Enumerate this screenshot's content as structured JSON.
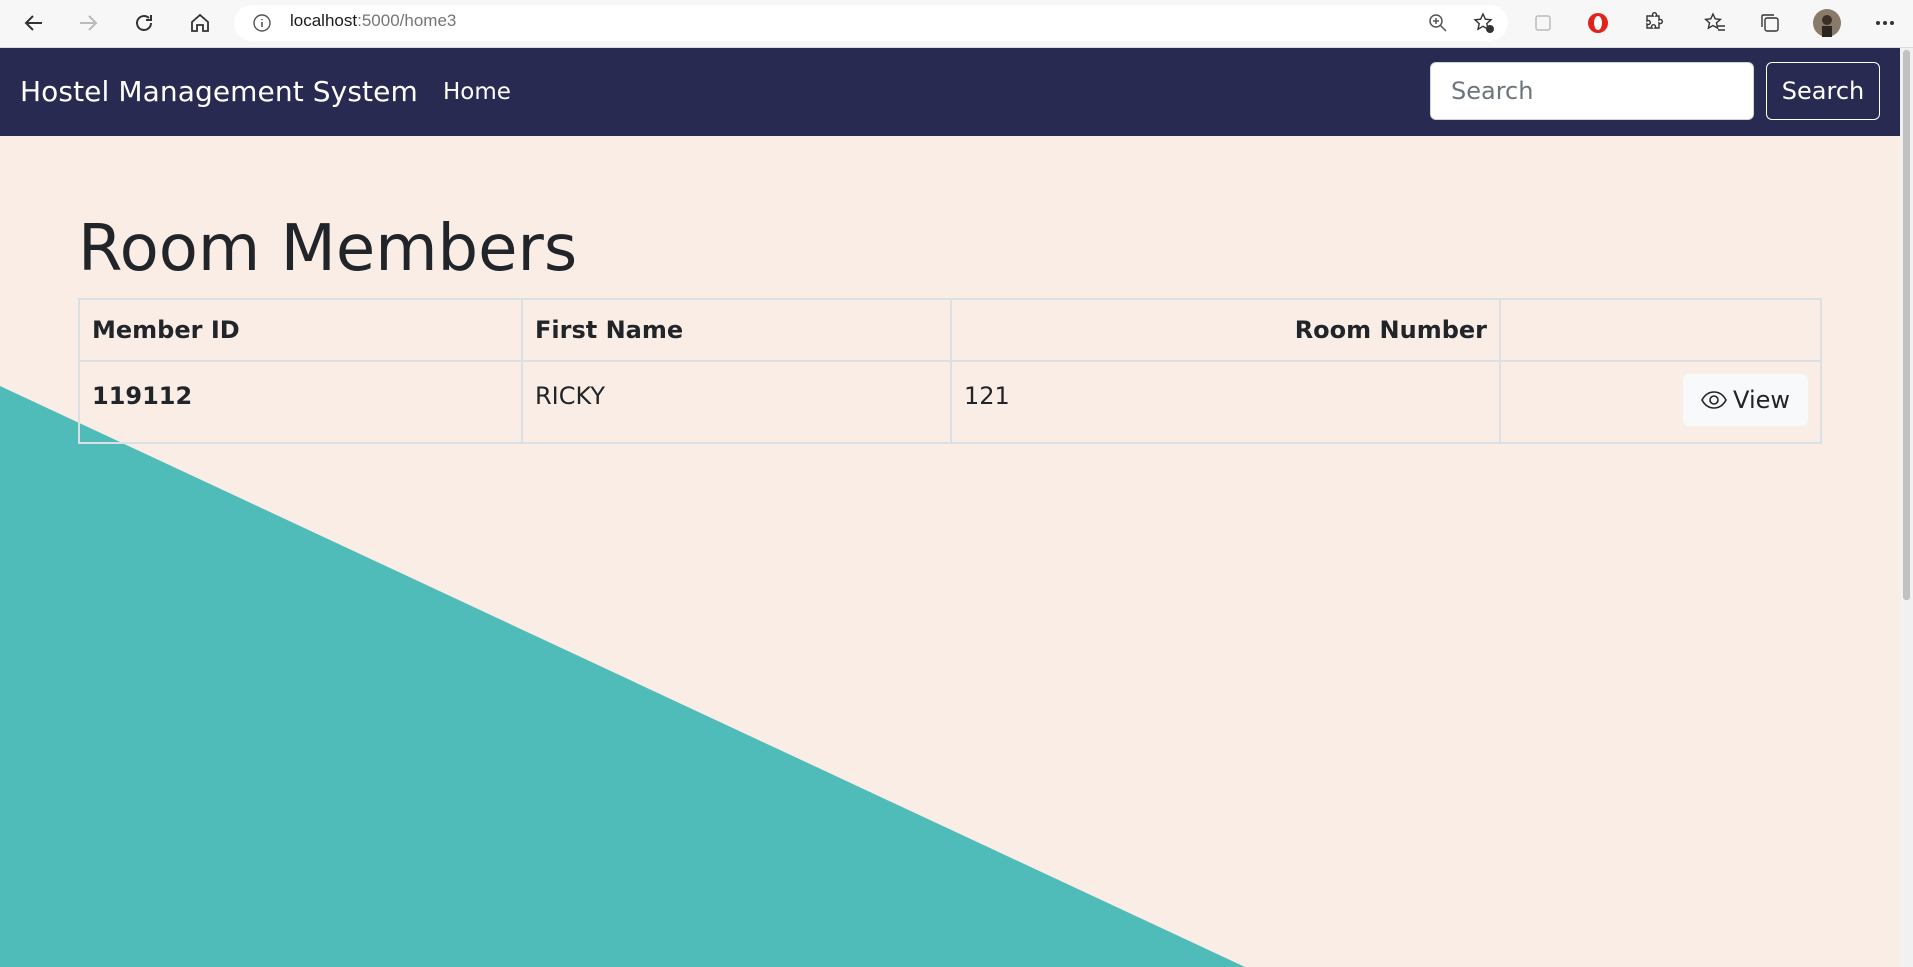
{
  "browser": {
    "url_host": "localhost",
    "url_path": ":5000/home3"
  },
  "navbar": {
    "brand": "Hostel Management System",
    "home": "Home",
    "search_placeholder": "Search",
    "search_button": "Search"
  },
  "main": {
    "title": "Room Members",
    "table": {
      "headers": [
        "Member ID",
        "First Name",
        "Room Number",
        ""
      ],
      "rows": [
        {
          "member_id": "119112",
          "first_name": "RICKY",
          "room_number": "121",
          "action": "View"
        }
      ]
    }
  },
  "colors": {
    "navbar": "#282a51",
    "background": "#faede5",
    "accent_teal": "#50bcba"
  }
}
